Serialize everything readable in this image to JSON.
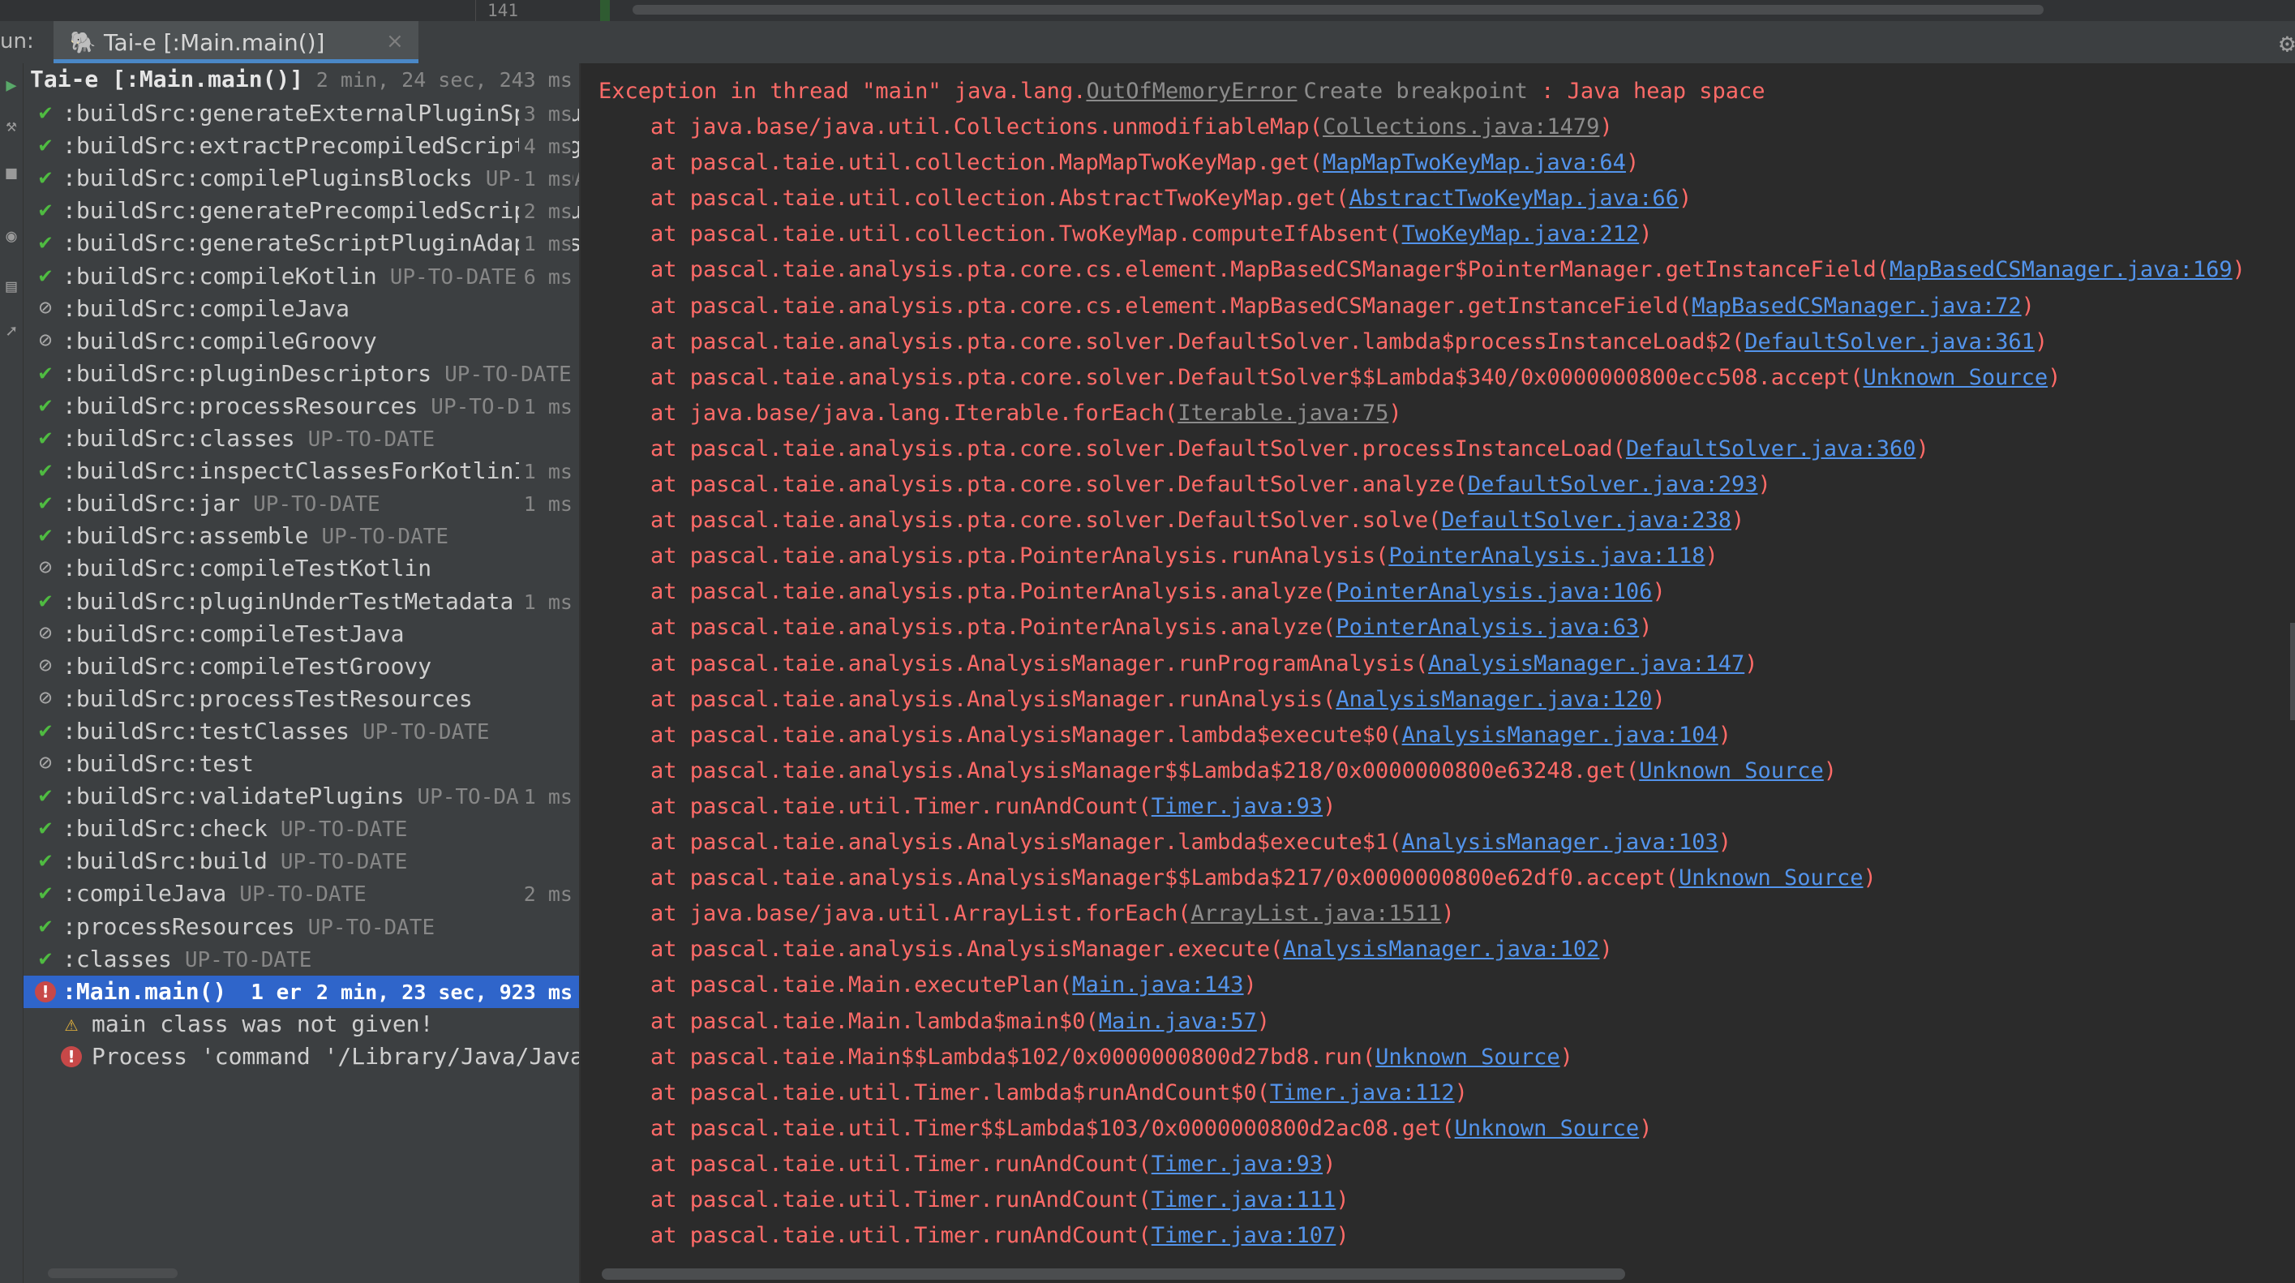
{
  "editor": {
    "line_number": "141"
  },
  "run_header": {
    "label": "un:",
    "tab_title": "Tai-e [:Main.main()]",
    "tab_icon": "gradle-elephant-icon",
    "close_glyph": "×",
    "gear_glyph": "⚙"
  },
  "toolbar": {
    "icons": [
      "rerun-icon",
      "wrench-icon",
      "stop-icon",
      "eye-icon",
      "layout-icon",
      "pin-icon"
    ]
  },
  "tree": {
    "root": {
      "label": "Tai-e [:Main.main()]",
      "duration": "2 min, 24 sec, 243 ms"
    },
    "tasks": [
      {
        "status": "ok",
        "name": ":buildSrc:generateExternalPluginSpecBuilders",
        "state": "",
        "duration": "3 ms"
      },
      {
        "status": "ok",
        "name": ":buildSrc:extractPrecompiledScriptPluginPlugins",
        "state": "",
        "duration": "4 ms"
      },
      {
        "status": "ok",
        "name": ":buildSrc:compilePluginsBlocks",
        "state": "UP-TO-DATE",
        "duration": "1 ms"
      },
      {
        "status": "ok",
        "name": ":buildSrc:generatePrecompiledScriptPluginAccessors",
        "state": "",
        "duration": "2 ms"
      },
      {
        "status": "ok",
        "name": ":buildSrc:generateScriptPluginAdapters",
        "state": "",
        "duration": "1 ms"
      },
      {
        "status": "ok",
        "name": ":buildSrc:compileKotlin",
        "state": "UP-TO-DATE",
        "duration": "6 ms"
      },
      {
        "status": "skip",
        "name": ":buildSrc:compileJava",
        "state": "",
        "duration": ""
      },
      {
        "status": "skip",
        "name": ":buildSrc:compileGroovy",
        "state": "",
        "duration": ""
      },
      {
        "status": "ok",
        "name": ":buildSrc:pluginDescriptors",
        "state": "UP-TO-DATE",
        "duration": ""
      },
      {
        "status": "ok",
        "name": ":buildSrc:processResources",
        "state": "UP-TO-DATE",
        "duration": "1 ms"
      },
      {
        "status": "ok",
        "name": ":buildSrc:classes",
        "state": "UP-TO-DATE",
        "duration": ""
      },
      {
        "status": "ok",
        "name": ":buildSrc:inspectClassesForKotlinIC",
        "state": "",
        "duration": "1 ms"
      },
      {
        "status": "ok",
        "name": ":buildSrc:jar",
        "state": "UP-TO-DATE",
        "duration": "1 ms"
      },
      {
        "status": "ok",
        "name": ":buildSrc:assemble",
        "state": "UP-TO-DATE",
        "duration": ""
      },
      {
        "status": "skip",
        "name": ":buildSrc:compileTestKotlin",
        "state": "",
        "duration": ""
      },
      {
        "status": "ok",
        "name": ":buildSrc:pluginUnderTestMetadata",
        "state": "",
        "duration": "1 ms"
      },
      {
        "status": "skip",
        "name": ":buildSrc:compileTestJava",
        "state": "",
        "duration": ""
      },
      {
        "status": "skip",
        "name": ":buildSrc:compileTestGroovy",
        "state": "",
        "duration": ""
      },
      {
        "status": "skip",
        "name": ":buildSrc:processTestResources",
        "state": "",
        "duration": ""
      },
      {
        "status": "ok",
        "name": ":buildSrc:testClasses",
        "state": "UP-TO-DATE",
        "duration": ""
      },
      {
        "status": "skip",
        "name": ":buildSrc:test",
        "state": "",
        "duration": ""
      },
      {
        "status": "ok",
        "name": ":buildSrc:validatePlugins",
        "state": "UP-TO-DATE",
        "duration": "1 ms"
      },
      {
        "status": "ok",
        "name": ":buildSrc:check",
        "state": "UP-TO-DATE",
        "duration": ""
      },
      {
        "status": "ok",
        "name": ":buildSrc:build",
        "state": "UP-TO-DATE",
        "duration": ""
      },
      {
        "status": "ok",
        "name": ":compileJava",
        "state": "UP-TO-DATE",
        "duration": "2 ms"
      },
      {
        "status": "ok",
        "name": ":processResources",
        "state": "UP-TO-DATE",
        "duration": ""
      },
      {
        "status": "ok",
        "name": ":classes",
        "state": "UP-TO-DATE",
        "duration": ""
      }
    ],
    "selected_task": {
      "name": ":Main.main()",
      "errors": "1 er",
      "duration": "2 min, 23 sec, 923 ms"
    },
    "messages": [
      {
        "type": "warning",
        "text": "main class was not given!"
      },
      {
        "type": "error",
        "text": "Process 'command '/Library/Java/JavaVirtualMachines"
      }
    ]
  },
  "console": {
    "cut_line": "     Exception in thread \"main\" java.lang.OutOfMemoryError: Java heap space ... ",
    "exception": {
      "prefix": "Exception in thread \"main\" java.lang.",
      "class": "OutOfMemoryError",
      "breakpoint": "Create breakpoint",
      "sep": " : ",
      "message": "Java heap space"
    },
    "trace": [
      {
        "method": "java.base/java.util.Collections.unmodifiableMap",
        "loc": "Collections.java:1479",
        "kind": "lib"
      },
      {
        "method": "pascal.taie.util.collection.MapMapTwoKeyMap.get",
        "loc": "MapMapTwoKeyMap.java:64",
        "kind": "link"
      },
      {
        "method": "pascal.taie.util.collection.AbstractTwoKeyMap.get",
        "loc": "AbstractTwoKeyMap.java:66",
        "kind": "link"
      },
      {
        "method": "pascal.taie.util.collection.TwoKeyMap.computeIfAbsent",
        "loc": "TwoKeyMap.java:212",
        "kind": "link"
      },
      {
        "method": "pascal.taie.analysis.pta.core.cs.element.MapBasedCSManager$PointerManager.getInstanceField",
        "loc": "MapBasedCSManager.java:169",
        "kind": "link"
      },
      {
        "method": "pascal.taie.analysis.pta.core.cs.element.MapBasedCSManager.getInstanceField",
        "loc": "MapBasedCSManager.java:72",
        "kind": "link"
      },
      {
        "method": "pascal.taie.analysis.pta.core.solver.DefaultSolver.lambda$processInstanceLoad$2",
        "loc": "DefaultSolver.java:361",
        "kind": "link"
      },
      {
        "method": "pascal.taie.analysis.pta.core.solver.DefaultSolver$$Lambda$340/0x0000000800ecc508.accept",
        "loc": "Unknown Source",
        "kind": "link"
      },
      {
        "method": "java.base/java.lang.Iterable.forEach",
        "loc": "Iterable.java:75",
        "kind": "lib"
      },
      {
        "method": "pascal.taie.analysis.pta.core.solver.DefaultSolver.processInstanceLoad",
        "loc": "DefaultSolver.java:360",
        "kind": "link"
      },
      {
        "method": "pascal.taie.analysis.pta.core.solver.DefaultSolver.analyze",
        "loc": "DefaultSolver.java:293",
        "kind": "link"
      },
      {
        "method": "pascal.taie.analysis.pta.core.solver.DefaultSolver.solve",
        "loc": "DefaultSolver.java:238",
        "kind": "link"
      },
      {
        "method": "pascal.taie.analysis.pta.PointerAnalysis.runAnalysis",
        "loc": "PointerAnalysis.java:118",
        "kind": "link"
      },
      {
        "method": "pascal.taie.analysis.pta.PointerAnalysis.analyze",
        "loc": "PointerAnalysis.java:106",
        "kind": "link"
      },
      {
        "method": "pascal.taie.analysis.pta.PointerAnalysis.analyze",
        "loc": "PointerAnalysis.java:63",
        "kind": "link"
      },
      {
        "method": "pascal.taie.analysis.AnalysisManager.runProgramAnalysis",
        "loc": "AnalysisManager.java:147",
        "kind": "link"
      },
      {
        "method": "pascal.taie.analysis.AnalysisManager.runAnalysis",
        "loc": "AnalysisManager.java:120",
        "kind": "link"
      },
      {
        "method": "pascal.taie.analysis.AnalysisManager.lambda$execute$0",
        "loc": "AnalysisManager.java:104",
        "kind": "link"
      },
      {
        "method": "pascal.taie.analysis.AnalysisManager$$Lambda$218/0x0000000800e63248.get",
        "loc": "Unknown Source",
        "kind": "link"
      },
      {
        "method": "pascal.taie.util.Timer.runAndCount",
        "loc": "Timer.java:93",
        "kind": "link"
      },
      {
        "method": "pascal.taie.analysis.AnalysisManager.lambda$execute$1",
        "loc": "AnalysisManager.java:103",
        "kind": "link"
      },
      {
        "method": "pascal.taie.analysis.AnalysisManager$$Lambda$217/0x0000000800e62df0.accept",
        "loc": "Unknown Source",
        "kind": "link"
      },
      {
        "method": "java.base/java.util.ArrayList.forEach",
        "loc": "ArrayList.java:1511",
        "kind": "lib"
      },
      {
        "method": "pascal.taie.analysis.AnalysisManager.execute",
        "loc": "AnalysisManager.java:102",
        "kind": "link"
      },
      {
        "method": "pascal.taie.Main.executePlan",
        "loc": "Main.java:143",
        "kind": "link"
      },
      {
        "method": "pascal.taie.Main.lambda$main$0",
        "loc": "Main.java:57",
        "kind": "link"
      },
      {
        "method": "pascal.taie.Main$$Lambda$102/0x0000000800d27bd8.run",
        "loc": "Unknown Source",
        "kind": "link"
      },
      {
        "method": "pascal.taie.util.Timer.lambda$runAndCount$0",
        "loc": "Timer.java:112",
        "kind": "link"
      },
      {
        "method": "pascal.taie.util.Timer$$Lambda$103/0x0000000800d2ac08.get",
        "loc": "Unknown Source",
        "kind": "link"
      },
      {
        "method": "pascal.taie.util.Timer.runAndCount",
        "loc": "Timer.java:93",
        "kind": "link"
      },
      {
        "method": "pascal.taie.util.Timer.runAndCount",
        "loc": "Timer.java:111",
        "kind": "link"
      },
      {
        "method": "pascal.taie.util.Timer.runAndCount",
        "loc": "Timer.java:107",
        "kind": "link"
      }
    ]
  },
  "colors": {
    "error_text": "#ff6b68",
    "link": "#5394ec",
    "ok_check": "#4fbb41",
    "selection": "#2f65ca"
  }
}
